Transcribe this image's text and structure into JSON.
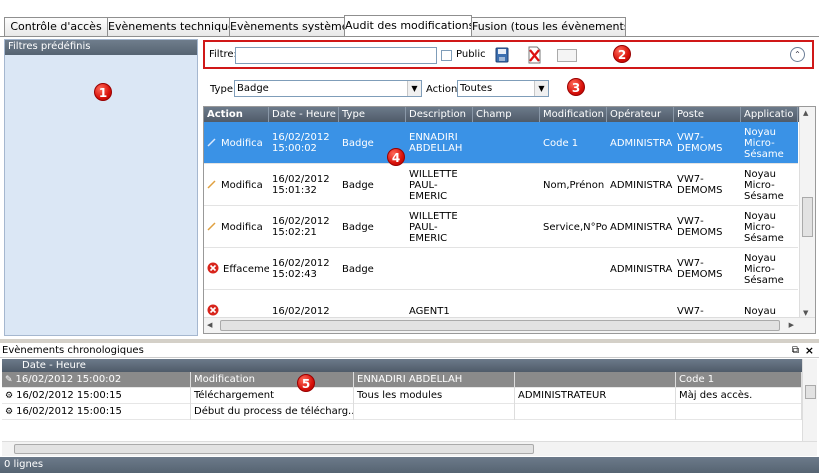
{
  "tabs": [
    {
      "label": "Contrôle d'accès"
    },
    {
      "label": "Evènements techniques"
    },
    {
      "label": "Evènements système"
    },
    {
      "label": "Audit des modifications"
    },
    {
      "label": "Fusion (tous les évènements)"
    }
  ],
  "active_tab": "Audit des modifications",
  "left_panel": {
    "title": "Filtres prédéfinis",
    "badge": "1"
  },
  "filter": {
    "label": "Filtre:",
    "value": "",
    "public_label": "Public",
    "public_checked": false,
    "badge": "2"
  },
  "type_filter": {
    "type_label": "Type",
    "type_value": "Badge",
    "action_label": "Action",
    "action_value": "Toutes",
    "badge": "3"
  },
  "grid": {
    "badge": "4",
    "columns": [
      "Action",
      "Date - Heure",
      "Type",
      "Description",
      "Champ",
      "Modification",
      "Opérateur",
      "Poste",
      "Applicatio"
    ],
    "rows": [
      {
        "action": "Modifica",
        "action_icon": "pencil-icon",
        "date": "16/02/2012 15:00:02",
        "type": "Badge",
        "description": "ENNADIRI ABDELLAH",
        "champ": "",
        "modification": "Code 1",
        "operateur": "ADMINISTRA",
        "poste": "VW7-DEMOMS",
        "application": "Noyau Micro-Sésame",
        "selected": true
      },
      {
        "action": "Modifica",
        "action_icon": "pencil-icon",
        "date": "16/02/2012 15:01:32",
        "type": "Badge",
        "description": "WILLETTE PAUL-EMERIC",
        "champ": "",
        "modification": "Nom,Prénon",
        "operateur": "ADMINISTRA",
        "poste": "VW7-DEMOMS",
        "application": "Noyau Micro-Sésame",
        "selected": false
      },
      {
        "action": "Modifica",
        "action_icon": "pencil-icon",
        "date": "16/02/2012 15:02:21",
        "type": "Badge",
        "description": "WILLETTE PAUL-EMERIC",
        "champ": "",
        "modification": "Service,N°Po",
        "operateur": "ADMINISTRA",
        "poste": "VW7-DEMOMS",
        "application": "Noyau Micro-Sésame",
        "selected": false
      },
      {
        "action": "Effaceme",
        "action_icon": "delete-icon",
        "date": "16/02/2012 15:02:43",
        "type": "Badge",
        "description": "",
        "champ": "",
        "modification": "",
        "operateur": "ADMINISTRA",
        "poste": "VW7-DEMOMS",
        "application": "Noyau Micro-Sésame",
        "selected": false
      },
      {
        "action": "",
        "action_icon": "delete-icon",
        "date": "16/02/2012",
        "type": "",
        "description": "AGENT1",
        "champ": "",
        "modification": "",
        "operateur": "",
        "poste": "VW7-",
        "application": "Noyau",
        "selected": false
      }
    ]
  },
  "bottom_panel": {
    "title": "Evènements chronologiques",
    "badge": "5",
    "columns": [
      "Date - Heure",
      "",
      "",
      "",
      ""
    ],
    "rows": [
      {
        "date": "16/02/2012 15:00:02",
        "c2": "Modification",
        "c3": "ENNADIRI ABDELLAH",
        "c4": "",
        "c5": "Code 1",
        "selected": true
      },
      {
        "date": "16/02/2012 15:00:15",
        "c2": "Téléchargement",
        "c3": "Tous les modules",
        "c4": "ADMINISTRATEUR",
        "c5": "Màj des accès.",
        "selected": false
      },
      {
        "date": "16/02/2012 15:00:15",
        "c2": "Début du process de télécharg...",
        "c3": "",
        "c4": "",
        "c5": "",
        "selected": false
      }
    ],
    "status": "0 lignes"
  },
  "colors": {
    "accent_selected": "#3a92e6",
    "highlight_border": "#d01818",
    "panel_bg": "#dbe7f5"
  }
}
